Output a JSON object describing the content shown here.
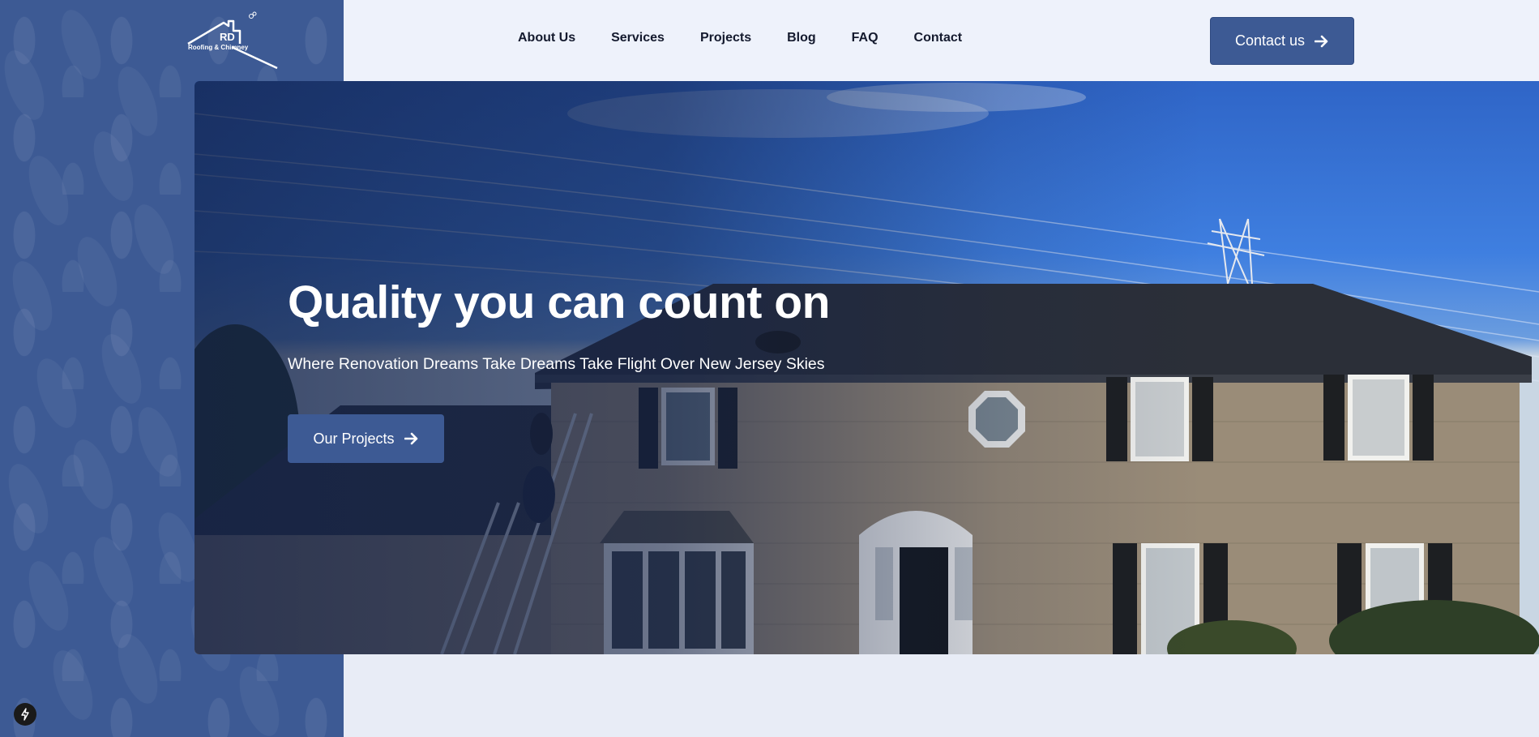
{
  "brand": {
    "mark": "RD",
    "subtitle": "Roofing & Chimney"
  },
  "nav": {
    "items": [
      {
        "label": "About Us"
      },
      {
        "label": "Services"
      },
      {
        "label": "Projects"
      },
      {
        "label": "Blog"
      },
      {
        "label": "FAQ"
      },
      {
        "label": "Contact"
      }
    ]
  },
  "header": {
    "cta_label": "Contact us",
    "cta_icon": "arrow-right-icon"
  },
  "hero": {
    "title": "Quality you can count on",
    "subtitle": "Where Renovation Dreams Take Dreams Take Flight Over New Jersey Skies",
    "button_label": "Our Projects",
    "button_icon": "arrow-right-icon",
    "image": "photo of brick colonial house with roofers on ladders"
  },
  "floating": {
    "icon": "lightning-bolt-icon"
  },
  "colors": {
    "primary": "#3d5a94",
    "nav_text": "#141a2e",
    "header_bg": "#eef2fb",
    "page_bg": "#e8ecf6"
  }
}
